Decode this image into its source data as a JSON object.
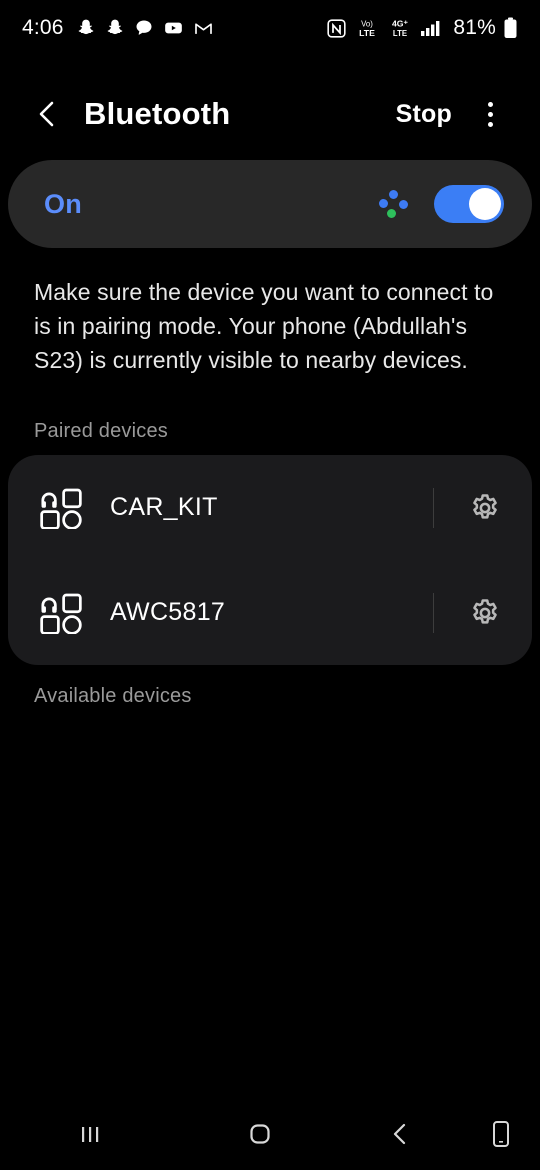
{
  "status_bar": {
    "time": "4:06",
    "battery_percent": "81%",
    "left_icons": [
      "snapchat-icon",
      "snapchat-icon",
      "chat-bubble-icon",
      "youtube-icon",
      "gmail-icon"
    ],
    "right_icons": [
      "nfc-icon",
      "volte-icon",
      "four-g-plus-lte-icon",
      "signal-bars-icon",
      "battery-icon"
    ],
    "nfc_label": "N",
    "volte_top": "Vo)",
    "volte_bottom": "LTE",
    "fourg_top": "4G",
    "fourg_bottom": "LTE"
  },
  "header": {
    "title": "Bluetooth",
    "stop_label": "Stop",
    "back_icon": "chevron-left-icon",
    "overflow_icon": "more-vertical-icon"
  },
  "toggle_card": {
    "state_label": "On",
    "scanning_indicator": "scanning-dots-icon",
    "switch_on": true,
    "accent_color": "#3b7ef5",
    "label_color": "#5b8dfb",
    "scan_green": "#2ebf5c"
  },
  "description": "Make sure the device you want to connect to is in pairing mode. Your phone (Abdullah's S23) is currently visible to nearby devices.",
  "sections": {
    "paired_label": "Paired devices",
    "available_label": "Available devices"
  },
  "paired_devices": [
    {
      "name": "CAR_KIT",
      "icon": "bluetooth-device-icon",
      "settings_icon": "gear-icon"
    },
    {
      "name": "AWC5817",
      "icon": "bluetooth-device-icon",
      "settings_icon": "gear-icon"
    }
  ],
  "available_devices": [],
  "nav_bar": {
    "recents_icon": "recents-icon",
    "home_icon": "home-icon",
    "back_icon": "back-chevron-icon",
    "device_icon": "phone-device-icon"
  }
}
